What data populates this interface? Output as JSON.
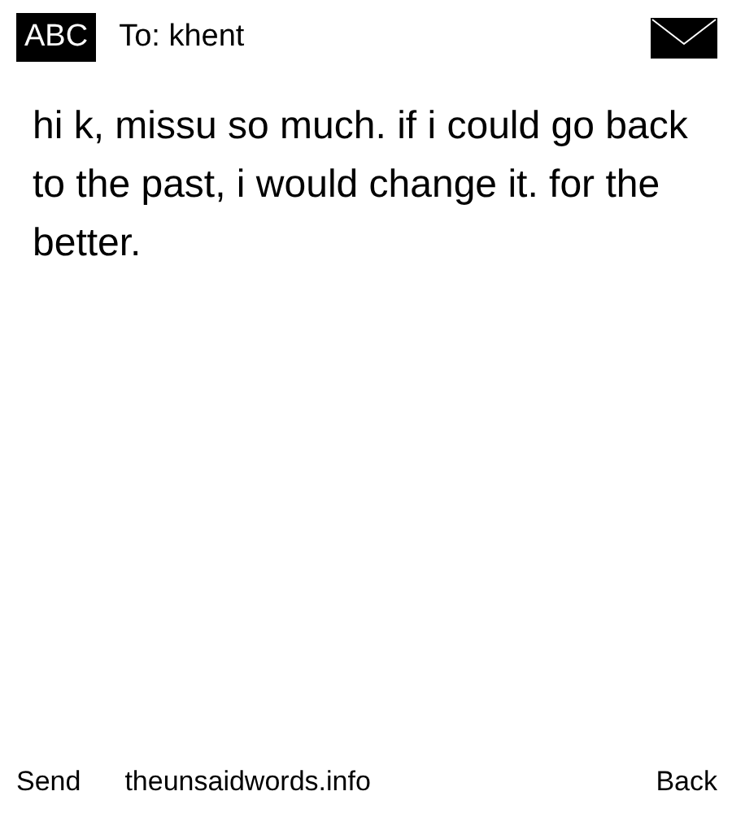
{
  "header": {
    "input_mode": "ABC",
    "recipient": "To: khent"
  },
  "message": "hi k, missu so much. if i could go back to the past, i would change it. for the better.",
  "softkeys": {
    "left": "Send",
    "center": "theunsaidwords.info",
    "right": "Back"
  }
}
